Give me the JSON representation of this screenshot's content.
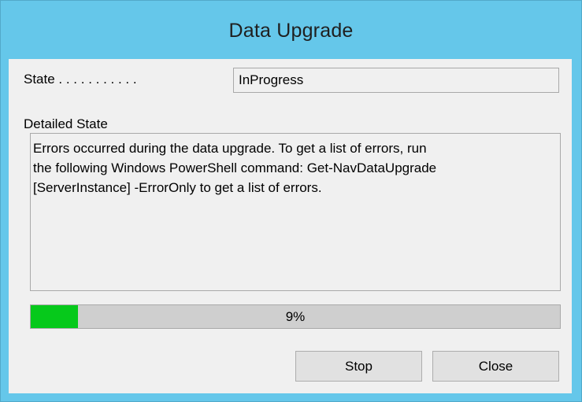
{
  "window": {
    "title": "Data Upgrade"
  },
  "state": {
    "label": "State . . . . . . . . . . .",
    "value": "InProgress"
  },
  "detailed_state": {
    "label": "Detailed State",
    "text": "Errors occurred during the data upgrade. To get a list of errors, run\nthe following Windows PowerShell command: Get-NavDataUpgrade\n[ServerInstance] -ErrorOnly to get a list of errors."
  },
  "progress": {
    "percent": 9,
    "label": "9%"
  },
  "buttons": {
    "stop": "Stop",
    "close": "Close"
  },
  "colors": {
    "titlebar": "#65c7ea",
    "progress_fill": "#06c91b",
    "progress_track": "#cfcfcf"
  }
}
